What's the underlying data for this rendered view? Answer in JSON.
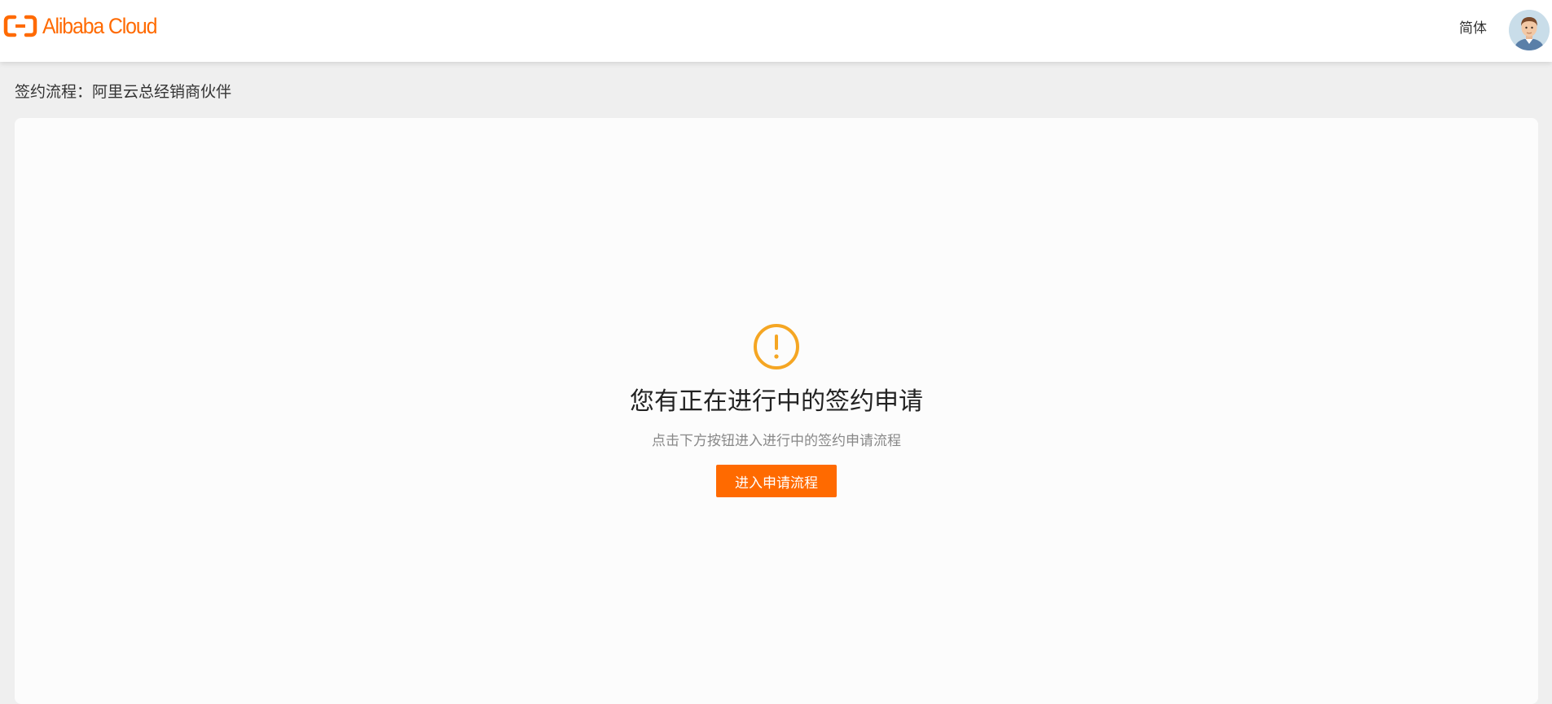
{
  "header": {
    "brand": "Alibaba Cloud",
    "language": "简体"
  },
  "breadcrumb": "签约流程：阿里云总经销商伙伴",
  "notice": {
    "icon": "warning-circle-icon",
    "title": "您有正在进行中的签约申请",
    "subtitle": "点击下方按钮进入进行中的签约申请流程",
    "button_label": "进入申请流程"
  },
  "colors": {
    "brand": "#ff6a00",
    "warning": "#f5a623"
  }
}
